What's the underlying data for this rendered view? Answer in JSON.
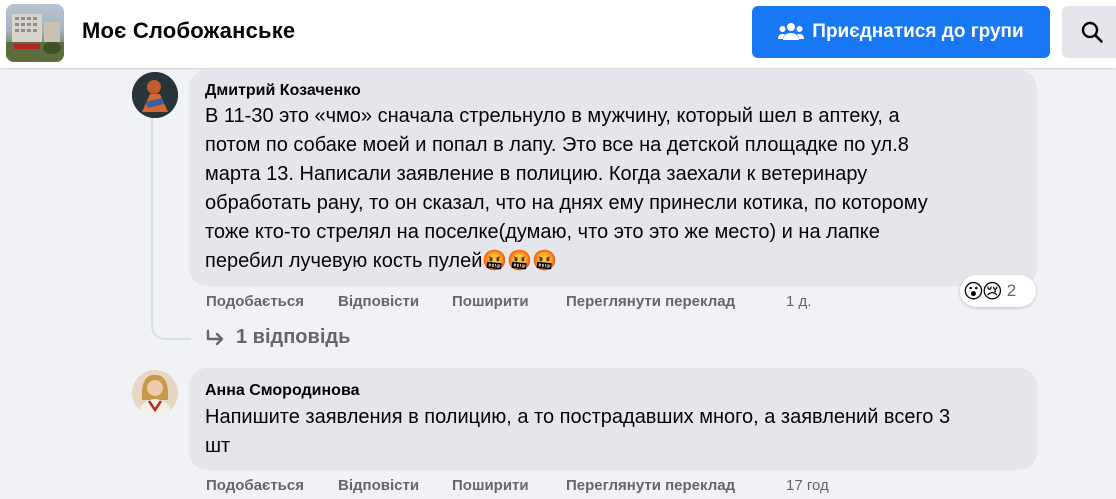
{
  "header": {
    "group_title": "Моє Слобожанське",
    "join_label": "Приєднатися до групи",
    "join_icon": "people-icon",
    "search_icon": "search-icon",
    "accent_color": "#1877f2"
  },
  "comments": [
    {
      "author": "Дмитрий Козаченко",
      "text_lines": [
        "В 11-30 это «чмо» сначала стрельнуло в мужчину, который шел в аптеку, а",
        "потом по собаке моей и попал в лапу. Это все на детской площадке по ул.8",
        "марта 13. Написали заявление в полицию. Когда заехали к ветеринару",
        "обработать рану, то он сказал, что на днях ему принесли котика, по которому",
        "тоже кто-то стрелял на поселке(думаю, что это это же место) и на лапке",
        "перебил лучевую кость пулей"
      ],
      "emojis": [
        "🤬",
        "🤬",
        "🤬"
      ],
      "actions": {
        "like": "Подобається",
        "reply": "Відповісти",
        "share": "Поширити",
        "translate": "Переглянути переклад",
        "time": "1 д."
      },
      "reactions": {
        "icons": [
          "😮",
          "😢"
        ],
        "count": "2"
      },
      "replies_label": "1 відповідь"
    },
    {
      "author": "Анна Смородинова",
      "text_lines": [
        "Напишите заявления в полицию, а то пострадавших много, а заявлений всего 3",
        "шт"
      ],
      "actions": {
        "like": "Подобається",
        "reply": "Відповісти",
        "share": "Поширити",
        "translate": "Переглянути переклад",
        "time": "17 год"
      }
    }
  ]
}
